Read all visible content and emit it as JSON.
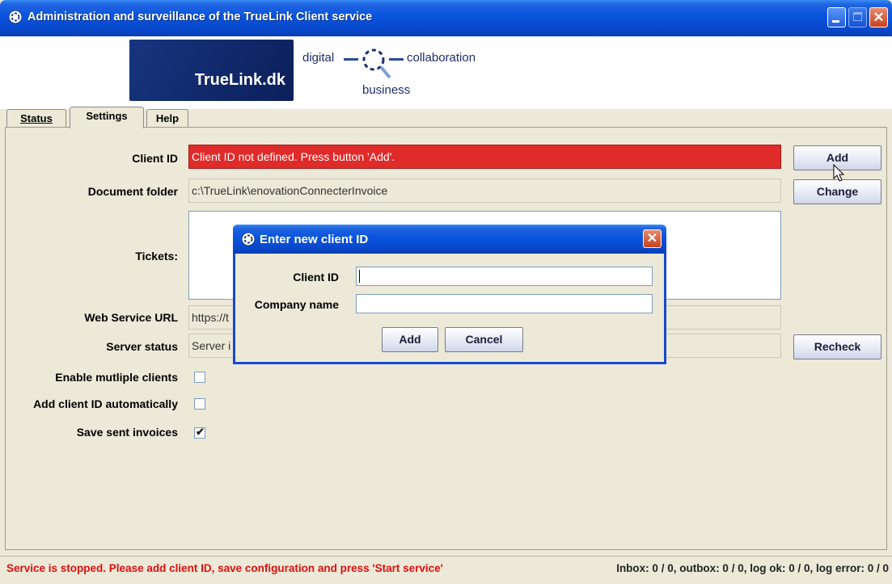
{
  "window": {
    "title": "Administration and surveillance of the TrueLink Client service",
    "icon": "truelink-app-icon",
    "controls": [
      "minimize",
      "maximize",
      "close"
    ]
  },
  "header": {
    "logo_text": "TrueLink.dk",
    "tagline": {
      "left": "digital",
      "right": "collaboration",
      "bottom": "business"
    }
  },
  "tabs": [
    {
      "label": "Status",
      "active": false
    },
    {
      "label": "Settings",
      "active": true
    },
    {
      "label": "Help",
      "active": false
    }
  ],
  "settings": {
    "client_id": {
      "label": "Client ID",
      "value": "Client ID not defined. Press button 'Add'.",
      "error_color": "#e02b2b"
    },
    "document_folder": {
      "label": "Document folder",
      "value": "c:\\TrueLink\\enovationConnecterInvoice"
    },
    "tickets": {
      "label": "Tickets:"
    },
    "web_service_url": {
      "label": "Web Service URL",
      "value": "https://t"
    },
    "server_status": {
      "label": "Server status",
      "value": "Server i"
    },
    "enable_multiple_clients": {
      "label": "Enable mutliple clients",
      "checked": false
    },
    "add_client_id_automatically": {
      "label": "Add client ID automatically",
      "checked": false
    },
    "save_sent_invoices": {
      "label": "Save sent invoices",
      "checked": true,
      "check_glyph": "✔"
    },
    "buttons": {
      "add": "Add",
      "change": "Change",
      "recheck": "Recheck"
    }
  },
  "dialog": {
    "title": "Enter new client ID",
    "close_glyph": "✕",
    "client_id_label": "Client ID",
    "client_id_value": "",
    "company_name_label": "Company name",
    "company_name_value": "",
    "add_button": "Add",
    "cancel_button": "Cancel"
  },
  "statusbar": {
    "message": "Service is stopped. Please add client ID, save configuration and press 'Start service'",
    "counters": "Inbox: 0 / 0, outbox: 0 / 0, log ok: 0 / 0, log error: 0 / 0"
  }
}
